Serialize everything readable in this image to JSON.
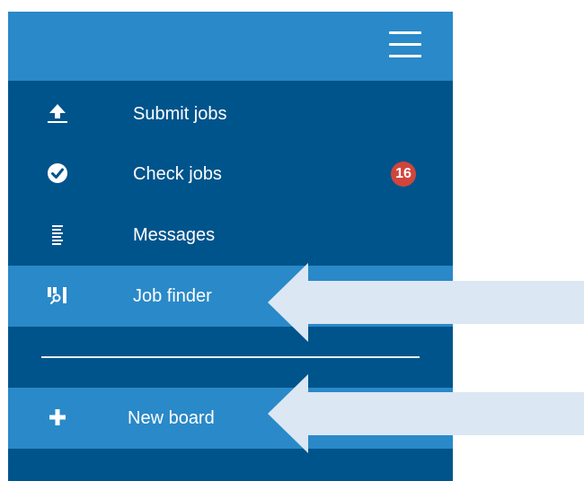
{
  "sidebar": {
    "items": [
      {
        "label": "Submit jobs",
        "icon": "upload-icon"
      },
      {
        "label": "Check jobs",
        "icon": "check-circle-icon",
        "badge": "16"
      },
      {
        "label": "Messages",
        "icon": "messages-icon"
      },
      {
        "label": "Job finder",
        "icon": "job-finder-icon",
        "active": true
      },
      {
        "label": "New board",
        "icon": "plus-icon",
        "active": true
      }
    ]
  },
  "colors": {
    "panel": "#00548c",
    "topbar": "#2a89c8",
    "active_item": "#2a89c8",
    "badge": "#d0453c",
    "arrow": "#dbe7f3"
  }
}
